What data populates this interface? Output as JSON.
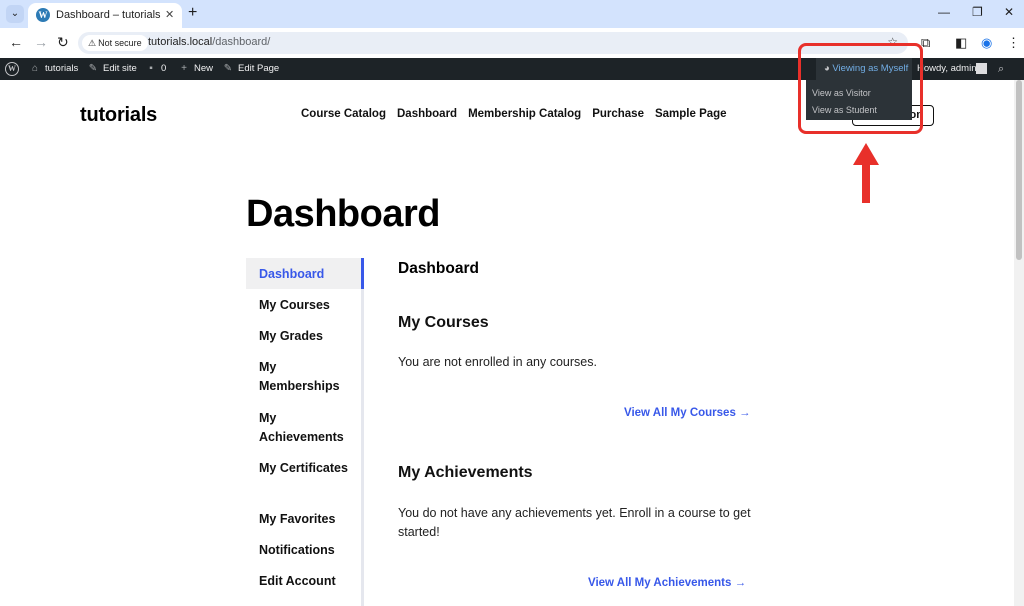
{
  "browser": {
    "tab_title": "Dashboard – tutorials",
    "tab_close": "✕",
    "new_tab": "+",
    "security_label": "Not secure",
    "url_host": "tutorials.local",
    "url_path": "/dashboard/"
  },
  "adminbar": {
    "site_name": "tutorials",
    "edit_site": "Edit site",
    "comments_count": "0",
    "new": "New",
    "edit_page": "Edit Page",
    "viewing_as": "Viewing as Myself",
    "howdy": "Howdy, admin",
    "dropdown": [
      "View as Visitor",
      "View as Student"
    ]
  },
  "site": {
    "title": "tutorials",
    "nav": [
      "Course Catalog",
      "Dashboard",
      "Membership Catalog",
      "Purchase",
      "Sample Page"
    ],
    "nav_button_visible": "on"
  },
  "page": {
    "title": "Dashboard"
  },
  "sidebar": {
    "items": [
      "Dashboard",
      "My Courses",
      "My Grades",
      "My Memberships",
      "My Achievements",
      "My Certificates",
      "My Favorites",
      "Notifications",
      "Edit Account"
    ],
    "active": "Dashboard"
  },
  "content": {
    "heading": "Dashboard",
    "courses_heading": "My Courses",
    "courses_text": "You are not enrolled in any courses.",
    "courses_link": "View All My Courses →",
    "achievements_heading": "My Achievements",
    "achievements_text": "You do not have any achievements yet. Enroll in a course to get started!",
    "achievements_link": "View All My Achievements →"
  },
  "colors": {
    "accent": "#3858e9",
    "annotation": "#e8302a",
    "adminbar": "#1d2327"
  }
}
